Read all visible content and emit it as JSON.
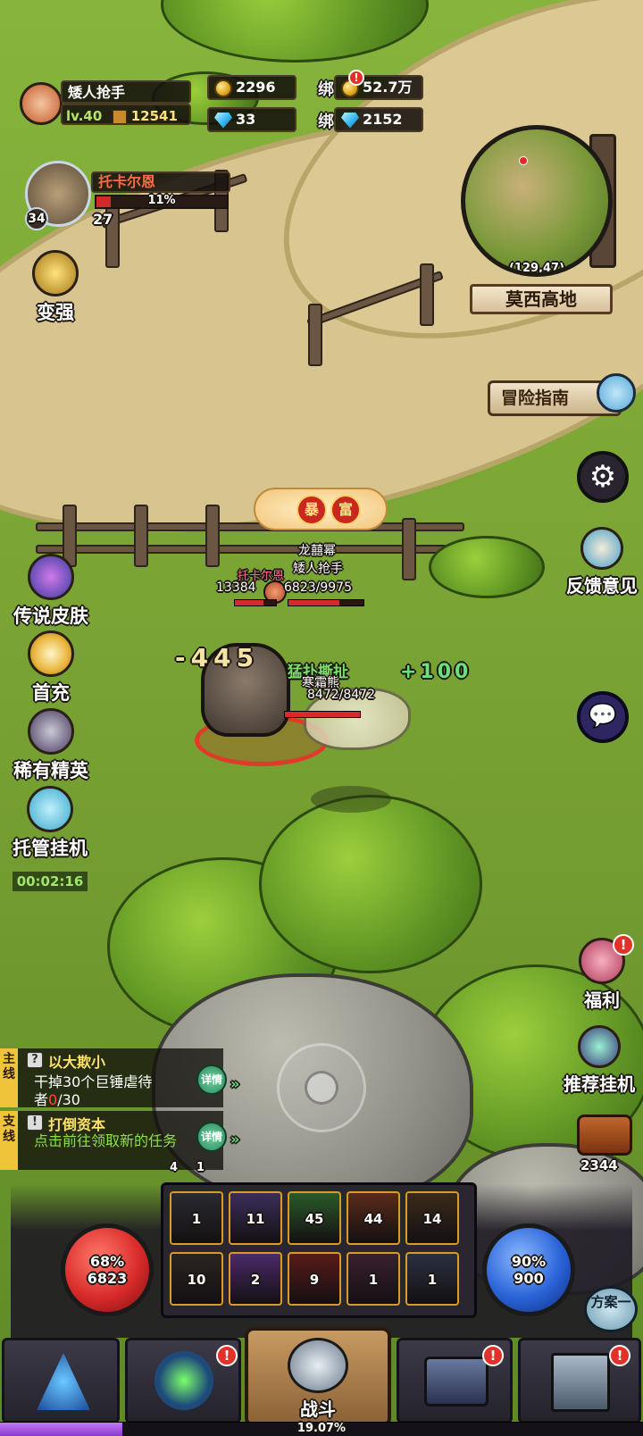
{
  "player": {
    "name": "矮人抢手",
    "level": "lv.40",
    "power": "12541"
  },
  "currency": {
    "gold": "2296",
    "bound_gold_label": "绑",
    "bound_gold": "52.7万",
    "diamond": "33",
    "bound_diamond_label": "绑",
    "bound_diamond": "2152"
  },
  "boss": {
    "name": "托卡尔恩",
    "progress": "11%",
    "progress_value": 0.11,
    "level": "34",
    "count": "27"
  },
  "minimap": {
    "coords": "(129,47)",
    "area": "莫西高地"
  },
  "left_menu": {
    "strengthen": "变强",
    "legend_skin": "传说皮肤",
    "first_charge": "首充",
    "rare_elite": "稀有精英",
    "auto_idle": "托管挂机",
    "timer": "00:02:16"
  },
  "right_menu": {
    "guide": "冒险指南",
    "feedback": "反馈意见",
    "welfare": "福利",
    "recommend_idle": "推荐挂机",
    "chest_count": "2344",
    "plan": "方案一"
  },
  "battle": {
    "event_label_1": "暴",
    "event_label_2": "富",
    "title": "龙囍幂",
    "player_name": "矮人抢手",
    "player_hp": "6823/9975",
    "enemy_name": "托卡尔恩",
    "enemy_hp": "13384",
    "damage": "-445",
    "skill_text": "猛扑撕扯",
    "mob_name": "寒霜熊",
    "mob_hp": "8472/8472",
    "heal": "+100"
  },
  "quests": [
    {
      "tag": "主线",
      "title": "以大欺小",
      "desc_1": "干掉30个巨锤虐待",
      "desc_2_prefix": "者",
      "progress_current": "0",
      "progress_total": "/30",
      "detail": "详情"
    },
    {
      "tag": "支线",
      "title": "打倒资本",
      "desc": "点击前往领取新的任务",
      "detail": "详情"
    }
  ],
  "skills": [
    "1",
    "11",
    "45",
    "44",
    "14",
    "10",
    "2",
    "9",
    "1",
    "1"
  ],
  "hp_orb": {
    "percent": "68%",
    "value": "6823"
  },
  "mp_orb": {
    "percent": "90%",
    "value": "900"
  },
  "buff_bar": {
    "a": "4",
    "b": "1"
  },
  "bottom_nav": {
    "battle": "战斗",
    "exp": "19.07%",
    "exp_value": 0.1907
  },
  "colors": {
    "hp": "#d82a2a",
    "mp": "#2a63d8",
    "accent_gold": "#f0c43a",
    "quest_green": "#8ee04a"
  }
}
